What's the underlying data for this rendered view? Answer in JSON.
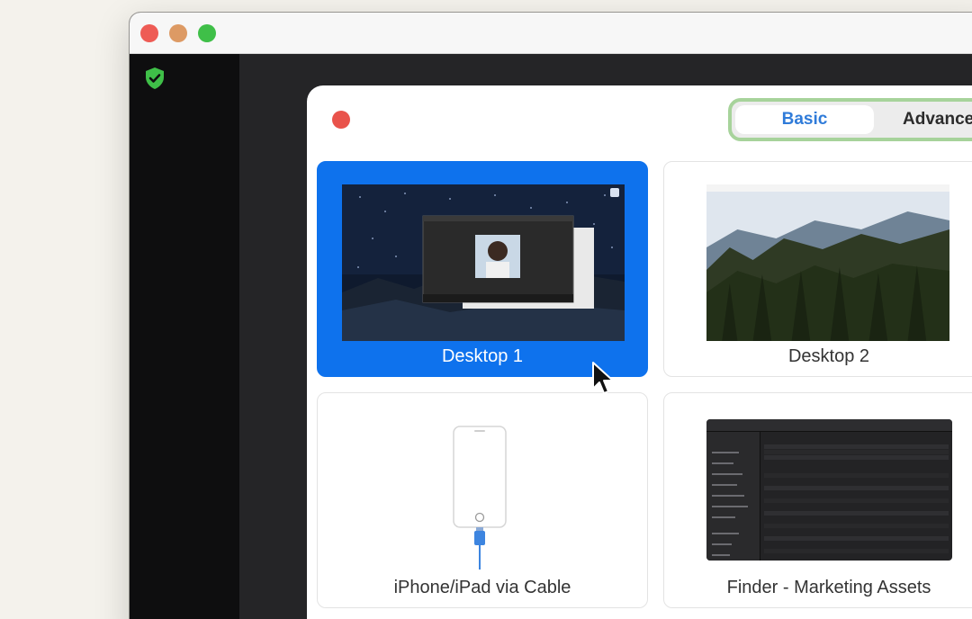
{
  "dialog": {
    "tabs": [
      {
        "label": "Basic",
        "active": true
      },
      {
        "label": "Advance",
        "active": false
      }
    ]
  },
  "share_options": [
    {
      "label": "Desktop 1",
      "selected": true
    },
    {
      "label": "Desktop 2",
      "selected": false
    },
    {
      "label": "iPhone/iPad via Cable",
      "selected": false
    },
    {
      "label": "Finder - Marketing Assets",
      "selected": false
    }
  ],
  "colors": {
    "selected_accent": "#0e72ed",
    "tab_active_text": "#2f7bd9",
    "tab_outline": "#a7d39b",
    "shield": "#3fbf48"
  }
}
